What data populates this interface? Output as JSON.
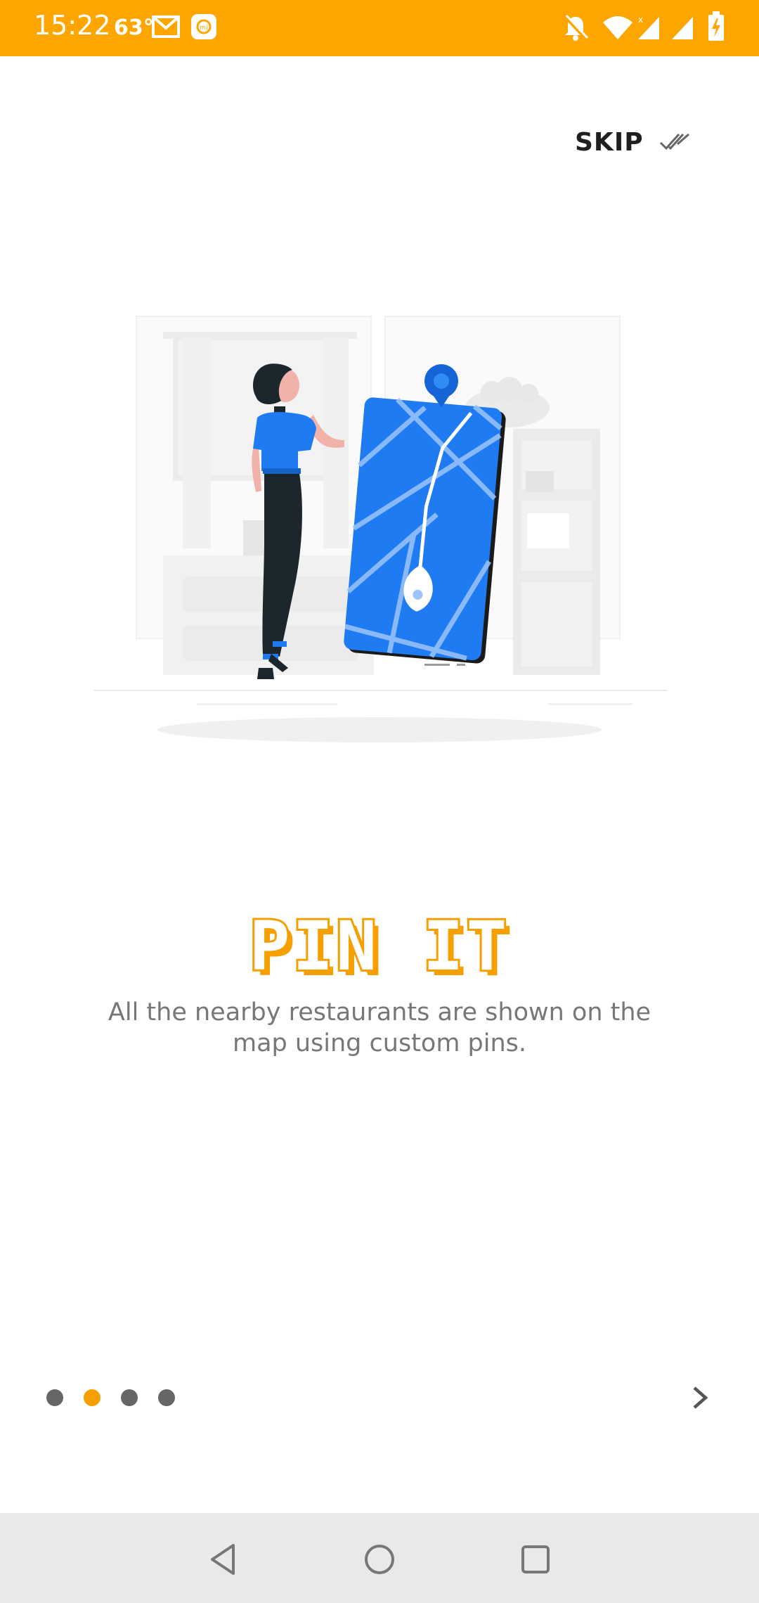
{
  "status_bar": {
    "time": "15:22",
    "temperature": "63°",
    "icons": [
      "gmail-icon",
      "mi-app-icon",
      "notifications-off-icon",
      "wifi-icon",
      "signal-icon",
      "signal-icon",
      "battery-charging-icon"
    ],
    "background": "#FFA500"
  },
  "header": {
    "skip_label": "SKIP"
  },
  "slide": {
    "title": "PIN IT",
    "description": "All the nearby restaurants are shown on the map using custom pins."
  },
  "pager": {
    "total": 4,
    "active_index": 1,
    "accent_color": "#F5A000"
  },
  "nav": {
    "buttons": [
      "back-icon",
      "home-icon",
      "recents-icon"
    ]
  }
}
